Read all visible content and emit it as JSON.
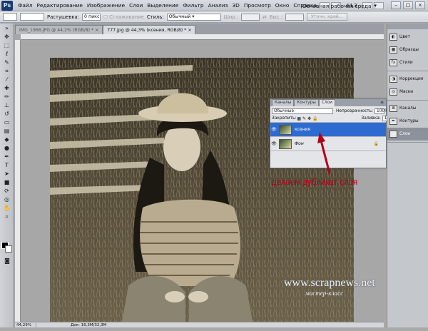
{
  "app": {
    "menu": [
      "Файл",
      "Редактирование",
      "Изображение",
      "Слои",
      "Выделение",
      "Фильтр",
      "Анализ",
      "3D",
      "Просмотр",
      "Окно",
      "Справка"
    ],
    "zoom_box": "44,3",
    "workspace": "Основная рабочая среда",
    "window_controls": [
      "–",
      "□",
      "×"
    ]
  },
  "options_bar": {
    "feather_label": "Растушевка:",
    "feather_value": "0 пикс",
    "antialias_label": "Сглаживание",
    "style_label": "Стиль:",
    "style_value": "Обычный",
    "width_label": "Шир.:",
    "height_label": "Выс.:",
    "refine_edge_button": "Уточн. край..."
  },
  "documents": {
    "tabs": [
      "IMG_1966.JPG @ 44,2% (RGB/8) *",
      "777.jpg @ 44,3% (ксения, RGB/8) *"
    ],
    "active_tab_index": 1
  },
  "status_bar": {
    "zoom": "44,29%",
    "doc_info": "Док: 16,3M/32,3M"
  },
  "layers_panel": {
    "tabs": [
      "Каналы",
      "Контуры",
      "Слои"
    ],
    "active_tab": "Слои",
    "blend_mode": "Обычные",
    "opacity_label": "Непрозрачность:",
    "opacity_value": "100%",
    "lock_label": "Закрепить:",
    "fill_label": "Заливка:",
    "fill_value": "100%",
    "layers": [
      {
        "name": "ксения",
        "selected": true,
        "locked": false
      },
      {
        "name": "Фон",
        "selected": false,
        "locked": true
      }
    ]
  },
  "dock": {
    "items": [
      {
        "label": "Цвет",
        "icon": "color-wheel-icon"
      },
      {
        "label": "Образцы",
        "icon": "swatches-icon"
      },
      {
        "label": "Стили",
        "icon": "styles-icon"
      },
      {
        "label": "Коррекция",
        "icon": "adjustments-icon"
      },
      {
        "label": "Маски",
        "icon": "masks-icon"
      },
      {
        "label": "Каналы",
        "icon": "channels-icon"
      },
      {
        "label": "Контуры",
        "icon": "paths-icon"
      },
      {
        "label": "Слои",
        "icon": "layers-icon"
      }
    ],
    "active": "Слои"
  },
  "annotation": {
    "text": "делаем дубликат слоя",
    "color": "#b3001a"
  },
  "watermark": {
    "site": "www.scrapnews.net",
    "subtitle": "мастер-класс"
  }
}
